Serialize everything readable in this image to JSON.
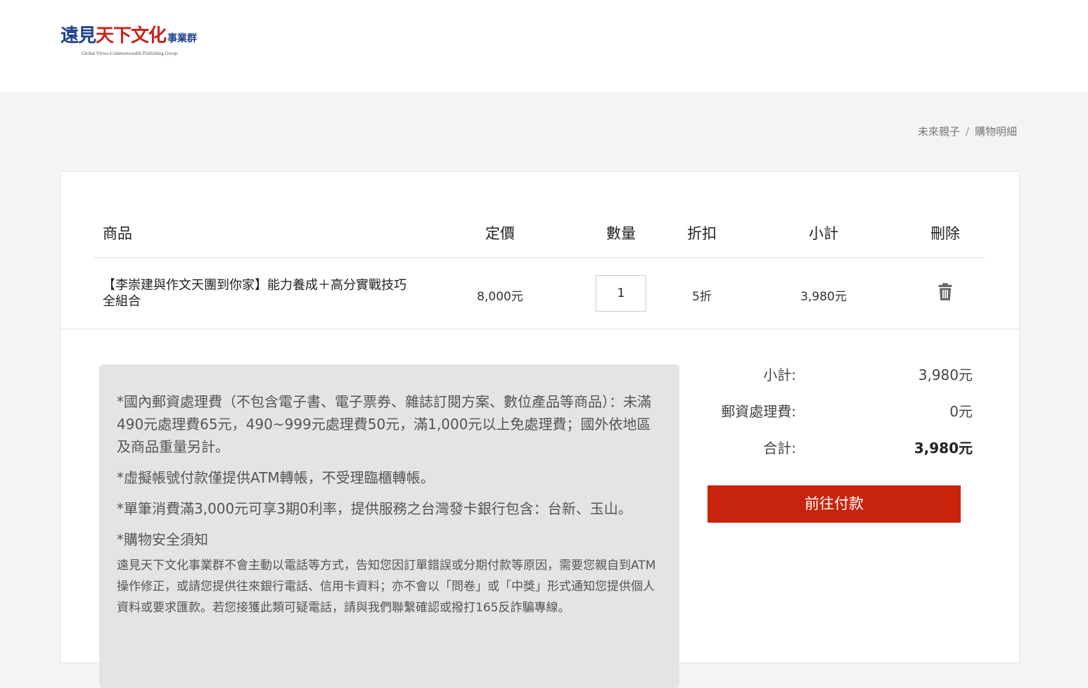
{
  "logo": {
    "main": "遠見",
    "red": "天下文化",
    "small": "事業群",
    "sub": "Global Views-Commonwealth Publishing Group"
  },
  "breadcrumb": {
    "items": [
      "未來親子",
      "購物明細"
    ],
    "separator": "/"
  },
  "cart": {
    "headers": {
      "product": "商品",
      "list_price": "定價",
      "quantity": "數量",
      "discount": "折扣",
      "subtotal": "小計",
      "delete": "刪除"
    },
    "items": [
      {
        "name": "【李崇建與作文天團到你家】能力養成＋高分實戰技巧全組合",
        "price": "8,000元",
        "quantity": "1",
        "discount": "5折",
        "subtotal": "3,980元"
      }
    ]
  },
  "notes": {
    "paragraphs": [
      "*國內郵資處理費（不包含電子書、電子票券、雜誌訂閱方案、數位產品等商品）：未滿490元處理費65元，490~999元處理費50元，滿1,000元以上免處理費；國外依地區及商品重量另計。",
      "*虛擬帳號付款僅提供ATM轉帳，不受理臨櫃轉帳。",
      "*單筆消費滿3,000元可享3期0利率，提供服務之台灣發卡銀行包含：台新、玉山。"
    ],
    "security_title": "*購物安全須知",
    "security_body": "遠見天下文化事業群不會主動以電話等方式，告知您因訂單錯誤或分期付款等原因，需要您親自到ATM操作修正，或請您提供往來銀行電話、信用卡資料；亦不會以「問卷」或「中獎」形式通知您提供個人資料或要求匯款。若您接獲此類可疑電話，請與我們聯繫確認或撥打165反詐騙專線。"
  },
  "summary": {
    "subtotal_label": "小計:",
    "subtotal_value": "3,980元",
    "shipping_label": "郵資處理費:",
    "shipping_value": "0元",
    "total_label": "合計:",
    "total_value": "3,980元",
    "pay_button": "前往付款"
  },
  "colors": {
    "accent": "#c8230c",
    "brand_blue": "#1d3f8e",
    "page_bg": "#f4f4f4"
  },
  "icons": {
    "delete": "trash-icon"
  }
}
